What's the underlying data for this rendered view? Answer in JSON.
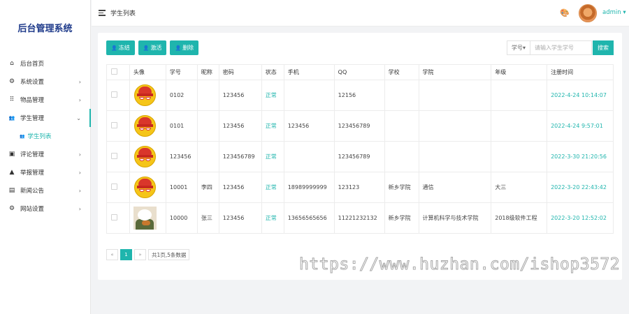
{
  "sidebar": {
    "logo": "后台管理系统",
    "items": [
      {
        "label": "后台首页",
        "icon": "home-icon",
        "glyph": "⌂"
      },
      {
        "label": "系统设置",
        "icon": "gear-icon",
        "glyph": "⚙"
      },
      {
        "label": "物品管理",
        "icon": "grid-icon",
        "glyph": "⠿"
      },
      {
        "label": "学生管理",
        "icon": "users-icon",
        "glyph": "👥"
      },
      {
        "label": "学生列表",
        "icon": "users-icon",
        "glyph": "👥"
      },
      {
        "label": "评论管理",
        "icon": "comment-icon",
        "glyph": "▣"
      },
      {
        "label": "举报管理",
        "icon": "warning-icon",
        "glyph": "▲"
      },
      {
        "label": "新闻公告",
        "icon": "news-icon",
        "glyph": "▤"
      },
      {
        "label": "网站设置",
        "icon": "gear-icon",
        "glyph": "⚙"
      }
    ]
  },
  "header": {
    "title": "学生列表",
    "user": "admin ▾"
  },
  "toolbar": {
    "freeze": "冻结",
    "activate": "激活",
    "delete": "删除"
  },
  "search": {
    "field": "学号▾",
    "placeholder": "请输入学生学号",
    "button": "搜索"
  },
  "table": {
    "headers": [
      "",
      "头像",
      "学号",
      "昵称",
      "密码",
      "状态",
      "手机",
      "QQ",
      "学校",
      "学院",
      "年级",
      "注册时间"
    ],
    "rows": [
      {
        "avatar": "cartoon",
        "id": "0102",
        "nick": "",
        "pwd": "123456",
        "status": "正常",
        "phone": "",
        "qq": "12156",
        "school": "",
        "college": "",
        "grade": "",
        "time": "2022-4-24 10:14:07"
      },
      {
        "avatar": "cartoon",
        "id": "0101",
        "nick": "",
        "pwd": "123456",
        "status": "正常",
        "phone": "123456",
        "qq": "123456789",
        "school": "",
        "college": "",
        "grade": "",
        "time": "2022-4-24 9:57:01"
      },
      {
        "avatar": "cartoon",
        "id": "123456",
        "nick": "",
        "pwd": "123456789",
        "status": "正常",
        "phone": "",
        "qq": "123456789",
        "school": "",
        "college": "",
        "grade": "",
        "time": "2022-3-30 21:20:56"
      },
      {
        "avatar": "cartoon",
        "id": "10001",
        "nick": "李四",
        "pwd": "123456",
        "status": "正常",
        "phone": "18989999999",
        "qq": "123123",
        "school": "新乡学院",
        "college": "通信",
        "grade": "大三",
        "time": "2022-3-20 22:43:42"
      },
      {
        "avatar": "photo",
        "id": "10000",
        "nick": "张三",
        "pwd": "123456",
        "status": "正常",
        "phone": "13656565656",
        "qq": "11221232132",
        "school": "新乡学院",
        "college": "计算机科学与技术学院",
        "grade": "2018级软件工程",
        "time": "2022-3-20 12:52:02"
      }
    ]
  },
  "pagination": {
    "prev": "«",
    "current": "1",
    "next": "»",
    "info": "共1页,5条数据"
  },
  "watermark": "https://www.huzhan.com/ishop3572",
  "colors": {
    "accent": "#1fb5ad",
    "logo": "#1e3a8a",
    "background": "#f2f3f5"
  }
}
